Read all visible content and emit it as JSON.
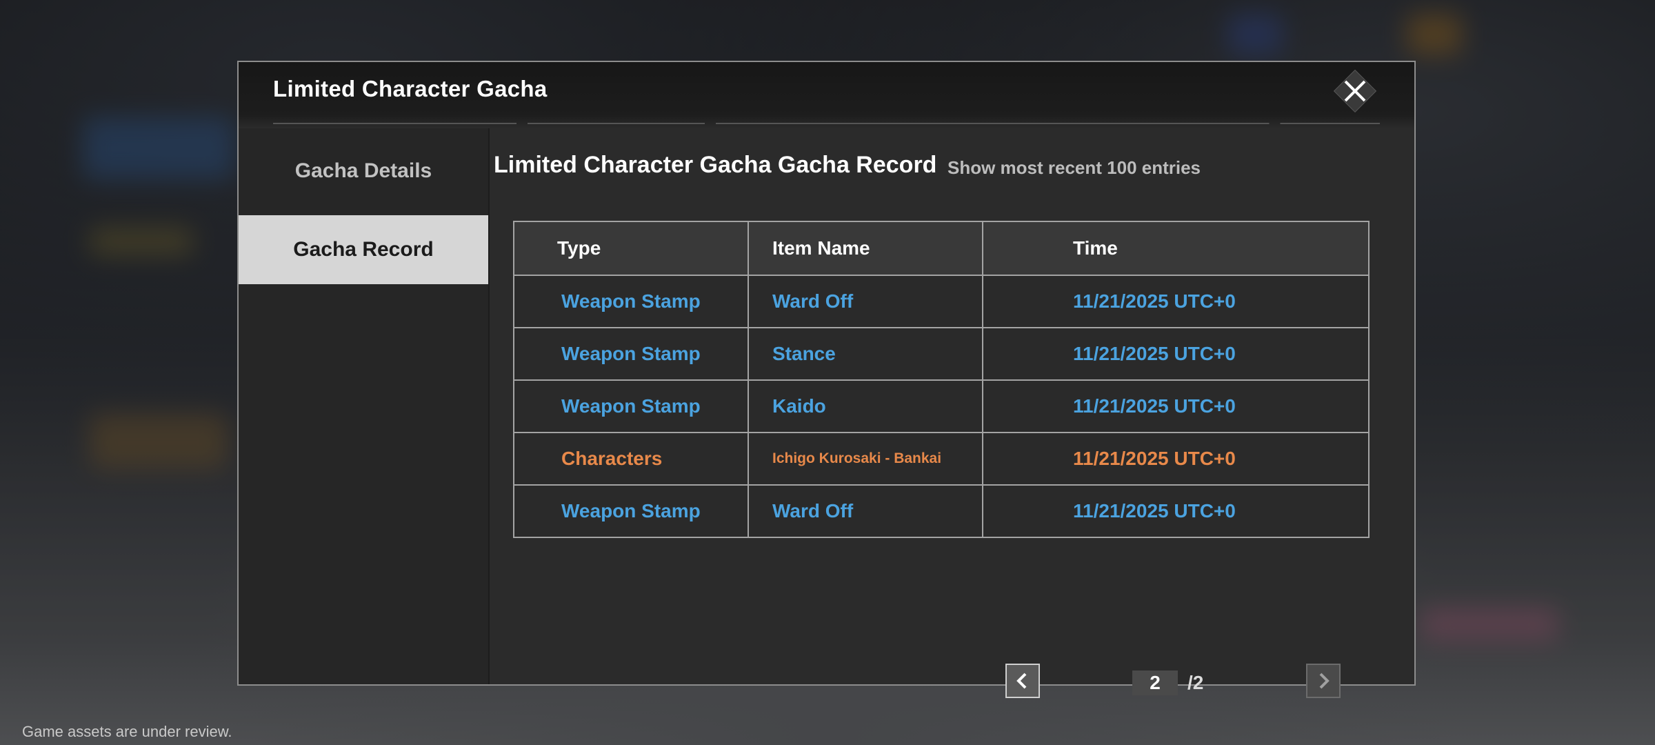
{
  "modal": {
    "title": "Limited Character Gacha",
    "close_icon": "close-icon"
  },
  "sidebar": {
    "items": [
      {
        "label": "Gacha Details",
        "active": false
      },
      {
        "label": "Gacha Record",
        "active": true
      }
    ]
  },
  "record": {
    "title": "Limited Character Gacha Gacha Record",
    "subtitle": "Show most recent 100 entries",
    "columns": [
      "Type",
      "Item Name",
      "Time"
    ],
    "rows": [
      {
        "type": "Weapon Stamp",
        "name": "Ward Off",
        "time": "11/21/2025 UTC+0",
        "color": "#4ba3e0"
      },
      {
        "type": "Weapon Stamp",
        "name": "Stance",
        "time": "11/21/2025 UTC+0",
        "color": "#4ba3e0"
      },
      {
        "type": "Weapon Stamp",
        "name": "Kaido",
        "time": "11/21/2025 UTC+0",
        "color": "#4ba3e0"
      },
      {
        "type": "Characters",
        "name": "Ichigo Kurosaki - Bankai",
        "time": "11/21/2025 UTC+0",
        "color": "#e8894a"
      },
      {
        "type": "Weapon Stamp",
        "name": "Ward Off",
        "time": "11/21/2025 UTC+0",
        "color": "#4ba3e0"
      }
    ]
  },
  "pagination": {
    "current": "2",
    "total": "/2",
    "prev_icon": "chevron-left-icon",
    "next_icon": "chevron-right-icon"
  },
  "footer": {
    "note": "Game assets are under review."
  }
}
